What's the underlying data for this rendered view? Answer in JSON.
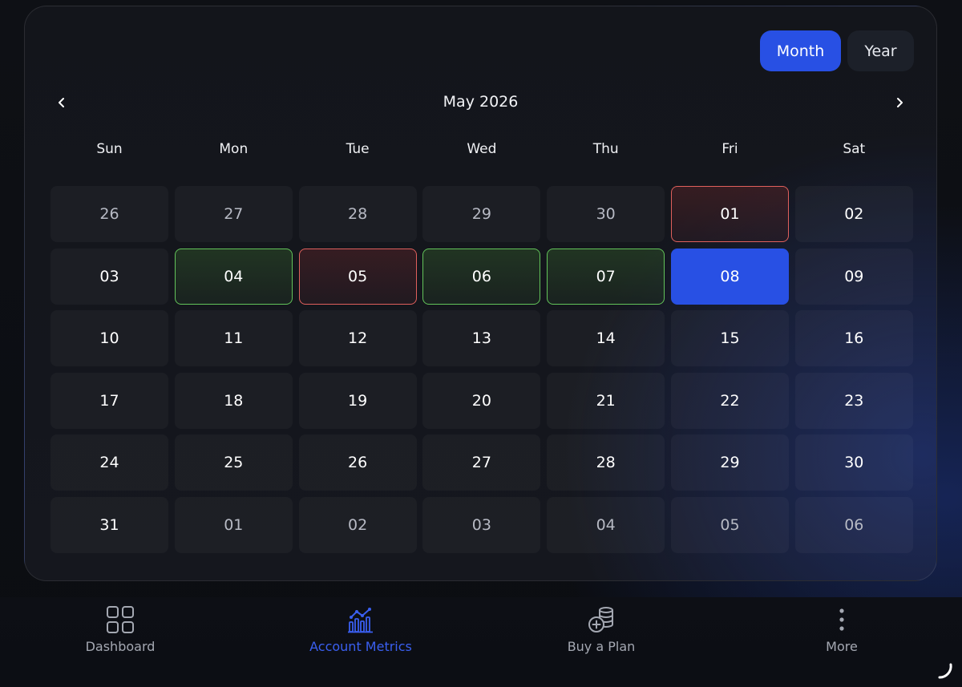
{
  "view_toggle": {
    "month_label": "Month",
    "year_label": "Year",
    "active": "Month"
  },
  "calendar": {
    "title": "May 2026",
    "prev_icon": "chevron-left-icon",
    "next_icon": "chevron-right-icon",
    "weekdays": [
      "Sun",
      "Mon",
      "Tue",
      "Wed",
      "Thu",
      "Fri",
      "Sat"
    ],
    "days": [
      {
        "label": "26",
        "state": "other"
      },
      {
        "label": "27",
        "state": "other"
      },
      {
        "label": "28",
        "state": "other"
      },
      {
        "label": "29",
        "state": "other"
      },
      {
        "label": "30",
        "state": "other"
      },
      {
        "label": "01",
        "state": "red"
      },
      {
        "label": "02",
        "state": "normal"
      },
      {
        "label": "03",
        "state": "normal"
      },
      {
        "label": "04",
        "state": "green"
      },
      {
        "label": "05",
        "state": "red"
      },
      {
        "label": "06",
        "state": "green"
      },
      {
        "label": "07",
        "state": "green"
      },
      {
        "label": "08",
        "state": "selected"
      },
      {
        "label": "09",
        "state": "normal"
      },
      {
        "label": "10",
        "state": "normal"
      },
      {
        "label": "11",
        "state": "normal"
      },
      {
        "label": "12",
        "state": "normal"
      },
      {
        "label": "13",
        "state": "normal"
      },
      {
        "label": "14",
        "state": "normal"
      },
      {
        "label": "15",
        "state": "normal"
      },
      {
        "label": "16",
        "state": "normal"
      },
      {
        "label": "17",
        "state": "normal"
      },
      {
        "label": "18",
        "state": "normal"
      },
      {
        "label": "19",
        "state": "normal"
      },
      {
        "label": "20",
        "state": "normal"
      },
      {
        "label": "21",
        "state": "normal"
      },
      {
        "label": "22",
        "state": "normal"
      },
      {
        "label": "23",
        "state": "normal"
      },
      {
        "label": "24",
        "state": "normal"
      },
      {
        "label": "25",
        "state": "normal"
      },
      {
        "label": "26",
        "state": "normal"
      },
      {
        "label": "27",
        "state": "normal"
      },
      {
        "label": "28",
        "state": "normal"
      },
      {
        "label": "29",
        "state": "normal"
      },
      {
        "label": "30",
        "state": "normal"
      },
      {
        "label": "31",
        "state": "normal"
      },
      {
        "label": "01",
        "state": "other"
      },
      {
        "label": "02",
        "state": "other"
      },
      {
        "label": "03",
        "state": "other"
      },
      {
        "label": "04",
        "state": "other"
      },
      {
        "label": "05",
        "state": "other"
      },
      {
        "label": "06",
        "state": "other"
      }
    ]
  },
  "bottom_nav": {
    "items": [
      {
        "label": "Dashboard",
        "icon": "dashboard-grid-icon",
        "active": false
      },
      {
        "label": "Account Metrics",
        "icon": "metrics-chart-icon",
        "active": true
      },
      {
        "label": "Buy a Plan",
        "icon": "coins-plus-icon",
        "active": false
      },
      {
        "label": "More",
        "icon": "more-vertical-icon",
        "active": false
      }
    ]
  },
  "colors": {
    "accent": "#2850e4",
    "success_border": "#63c45a",
    "danger_border": "#e0605c",
    "nav_inactive": "#a4a8b2",
    "nav_active": "#3a5ff0"
  }
}
